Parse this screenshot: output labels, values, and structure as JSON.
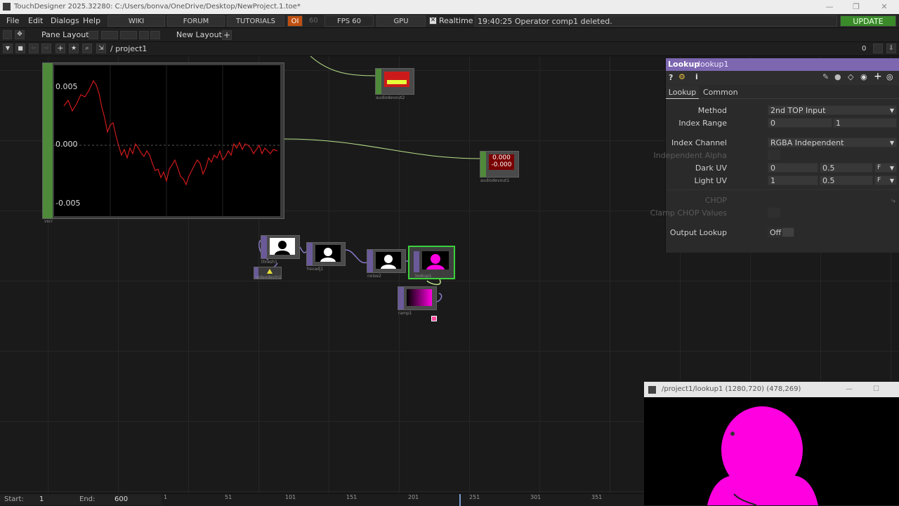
{
  "app": {
    "title": "TouchDesigner 2025.32280: C:/Users/bonva/OneDrive/Desktop/NewProject.1.toe*"
  },
  "menu": {
    "file": "File",
    "edit": "Edit",
    "dialogs": "Dialogs",
    "help": "Help",
    "wiki": "WIKI",
    "forum": "FORUM",
    "tutorials": "TUTORIALS",
    "oi": "OI",
    "oi_num": "60",
    "fps": "FPS  60",
    "gpu": "GPU",
    "realtime": "Realtime",
    "status": "19:40:25 Operator comp1 deleted.",
    "update": "UPDATE"
  },
  "pane": {
    "layout": "Pane Layout",
    "new_layout": "New Layout"
  },
  "path": {
    "text": "/ project1",
    "count": "0"
  },
  "chop_view": {
    "ticks": [
      "0.005",
      "0.000",
      "-0.005"
    ]
  },
  "nodes": {
    "threshold": "thresh1",
    "hsvadjust": "hsvadj1",
    "noise": "noise2",
    "lookup": "lookup1",
    "ramp": "ramp1",
    "videodevin": "videodevin1",
    "analyze1": "audiodevout2",
    "analyze2": "audiodevout1",
    "chop_big": "vscr",
    "num1": "0.000",
    "num2": "-0.000"
  },
  "params": {
    "op_type": "Lookup",
    "op_name": "lookup1",
    "tabs": [
      "Lookup",
      "Common"
    ],
    "method_label": "Method",
    "method_value": "2nd TOP Input",
    "index_range_label": "Index Range",
    "index_range_a": "0",
    "index_range_b": "1",
    "index_channel_label": "Index Channel",
    "index_channel_value": "RGBA Independent",
    "indep_alpha_label": "Independent Alpha",
    "dark_uv_label": "Dark UV",
    "dark_uv_a": "0",
    "dark_uv_b": "0.5",
    "dark_uv_c": "F",
    "light_uv_label": "Light UV",
    "light_uv_a": "1",
    "light_uv_b": "0.5",
    "light_uv_c": "F",
    "chop_label": "CHOP",
    "clamp_label": "Clamp CHOP Values",
    "output_lookup_label": "Output Lookup",
    "output_lookup_value": "Off"
  },
  "viewer": {
    "title": "/project1/lookup1 (1280,720) (478,269)"
  },
  "timeline": {
    "start_label": "Start:",
    "start_value": "1",
    "end_label": "End:",
    "end_value": "600",
    "ticks": [
      "1",
      "51",
      "101",
      "151",
      "201",
      "251",
      "301",
      "351"
    ]
  },
  "colors": {
    "param_header": "#7d67b0",
    "update": "#3a8a2a",
    "wire_green": "#b8e08a",
    "chop_red": "#cc1a1a",
    "magenta": "#ff00e0"
  }
}
